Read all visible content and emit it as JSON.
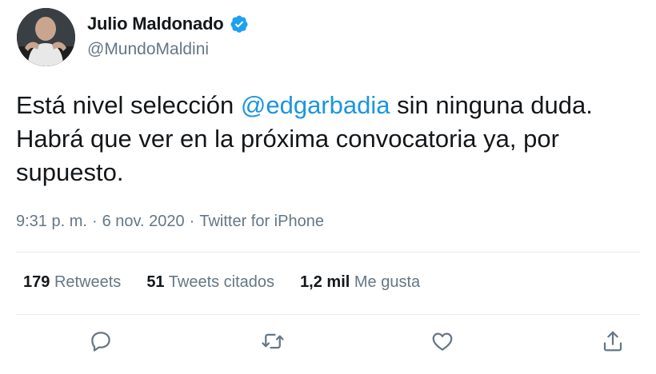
{
  "author": {
    "display_name": "Julio Maldonado",
    "handle": "@MundoMaldini",
    "verified_icon": "verified-badge-icon",
    "avatar_icon": "profile-photo-icon"
  },
  "tweet": {
    "text_before_mention": "Está nivel selección ",
    "mention": "@edgarbadia",
    "text_after_mention": " sin ninguna duda. Habrá que ver en la próxima convocatoria ya, por supuesto.",
    "time": "9:31 p. m.",
    "separator": "·",
    "date": "6 nov. 2020",
    "source": "Twitter for iPhone"
  },
  "stats": {
    "retweets_count": "179",
    "retweets_label": "Retweets",
    "quotes_count": "51",
    "quotes_label": "Tweets citados",
    "likes_count": "1,2 mil",
    "likes_label": "Me gusta"
  },
  "actions": {
    "reply_icon": "reply-icon",
    "retweet_icon": "retweet-icon",
    "like_icon": "heart-icon",
    "share_icon": "share-icon"
  },
  "colors": {
    "text": "#14171a",
    "secondary": "#657786",
    "link": "#1b95e0",
    "divider": "#e6ecf0",
    "verified": "#1da1f2"
  }
}
